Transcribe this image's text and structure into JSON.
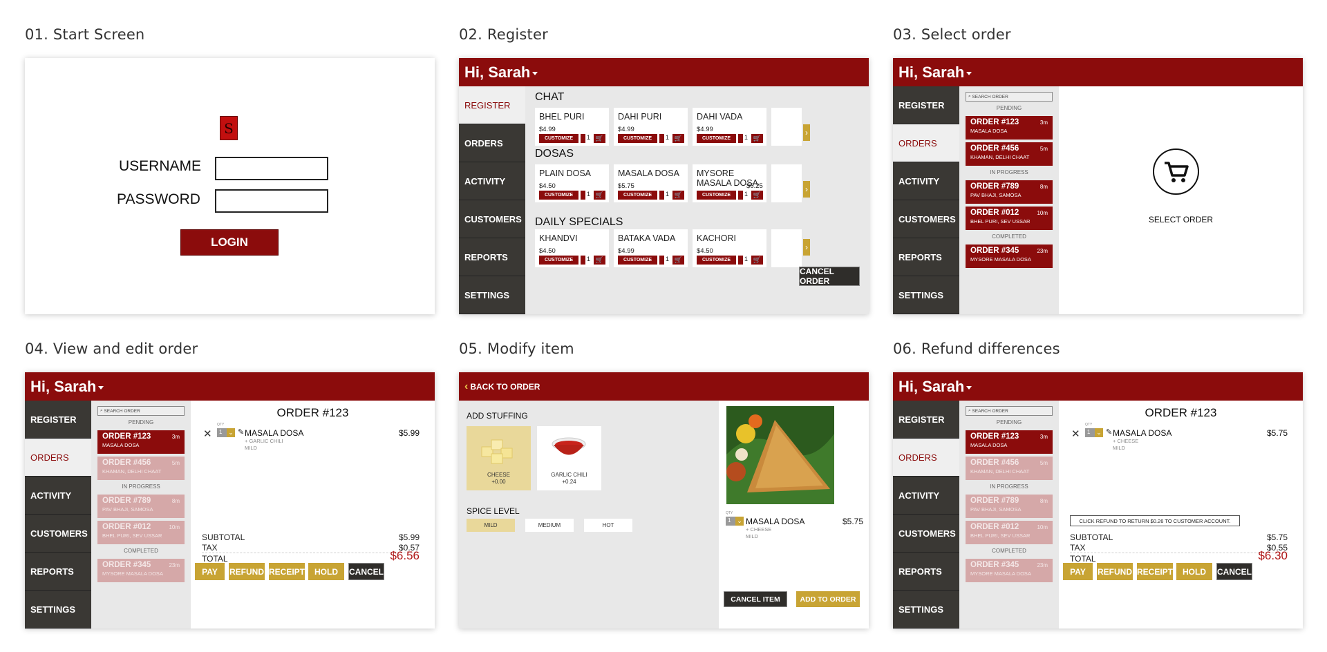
{
  "panels": {
    "p1": {
      "label": "01. Start Screen"
    },
    "p2": {
      "label": "02. Register"
    },
    "p3": {
      "label": "03. Select order"
    },
    "p4": {
      "label": "04. View and edit order"
    },
    "p5": {
      "label": "05. Modify item"
    },
    "p6": {
      "label": "06. Refund differences"
    }
  },
  "login": {
    "logo_letter": "S",
    "username_label": "USERNAME",
    "password_label": "PASSWORD",
    "login_button": "LOGIN"
  },
  "header": {
    "greeting": "Hi, Sarah"
  },
  "nav": [
    "REGISTER",
    "ORDERS",
    "ACTIVITY",
    "CUSTOMERS",
    "REPORTS",
    "SETTINGS"
  ],
  "register": {
    "categories": [
      {
        "name": "CHAT",
        "items": [
          {
            "name": "BHEL PURI",
            "price": "$4.99"
          },
          {
            "name": "DAHI PURI",
            "price": "$4.99"
          },
          {
            "name": "DAHI VADA",
            "price": "$4.99"
          }
        ]
      },
      {
        "name": "DOSAS",
        "items": [
          {
            "name": "PLAIN DOSA",
            "price": "$4.50"
          },
          {
            "name": "MASALA DOSA",
            "price": "$5.75"
          },
          {
            "name": "MYSORE MASALA DOSA",
            "price": "$6.25"
          }
        ]
      },
      {
        "name": "DAILY SPECIALS",
        "items": [
          {
            "name": "KHANDVI",
            "price": "$4.50"
          },
          {
            "name": "BATAKA VADA",
            "price": "$4.99"
          },
          {
            "name": "KACHORI",
            "price": "$4.50"
          }
        ]
      }
    ],
    "customize_label": "CUSTOMIZE",
    "qty": "1",
    "cancel_order": "CANCEL ORDER"
  },
  "orders": {
    "search_placeholder": "SEARCH ORDER",
    "pending_label": "PENDING",
    "in_progress_label": "IN PROGRESS",
    "completed_label": "COMPLETED",
    "list": [
      {
        "number": "ORDER #123",
        "time": "3m",
        "desc": "MASALA DOSA"
      },
      {
        "number": "ORDER #456",
        "time": "5m",
        "desc": "KHAMAN, DELHI CHAAT"
      },
      {
        "number": "ORDER #789",
        "time": "8m",
        "desc": "PAV BHAJI, SAMOSA"
      },
      {
        "number": "ORDER #012",
        "time": "10m",
        "desc": "BHEL PURI, SEV USSAR"
      },
      {
        "number": "ORDER #345",
        "time": "23m",
        "desc": "MYSORE MASALA DOSA"
      }
    ],
    "select_order": "SELECT ORDER"
  },
  "order_view": {
    "title": "ORDER #123",
    "qty_label": "QTY",
    "qty": "1",
    "item_name": "MASALA DOSA",
    "item_price": "$5.99",
    "mod1": "+ GARLIC CHILI",
    "mod2": "MILD",
    "subtotal_label": "SUBTOTAL",
    "subtotal": "$5.99",
    "tax_label": "TAX",
    "tax": "$0.57",
    "total_label": "TOTAL",
    "total": "$6.56",
    "buttons": [
      "PAY",
      "REFUND",
      "RECEIPT",
      "HOLD",
      "CANCEL"
    ]
  },
  "modify": {
    "back": "BACK TO ORDER",
    "add_stuffing": "ADD STUFFING",
    "stuffing": [
      {
        "name": "CHEESE",
        "price": "+0.00"
      },
      {
        "name": "GARLIC CHILI",
        "price": "+0.24"
      }
    ],
    "spice_level": "SPICE LEVEL",
    "spice": [
      "MILD",
      "MEDIUM",
      "HOT"
    ],
    "qty_label": "QTY",
    "qty": "1",
    "item_name": "MASALA DOSA",
    "item_price": "$5.75",
    "mod1": "+ CHEESE",
    "mod2": "MILD",
    "cancel_item": "CANCEL ITEM",
    "add_to_order": "ADD TO ORDER"
  },
  "refund": {
    "title": "ORDER #123",
    "qty_label": "QTY",
    "qty": "1",
    "item_name": "MASALA DOSA",
    "item_price": "$5.75",
    "mod1": "+ CHEESE",
    "mod2": "MILD",
    "notice": "CLICK REFUND TO RETURN $0.26 TO CUSTOMER ACCOUNT.",
    "subtotal_label": "SUBTOTAL",
    "subtotal": "$5.75",
    "tax_label": "TAX",
    "tax": "$0.55",
    "total_label": "TOTAL",
    "total": "$6.30",
    "buttons": [
      "PAY",
      "REFUND",
      "RECEIPT",
      "HOLD",
      "CANCEL"
    ]
  },
  "colors": {
    "brand": "#8b0c0c",
    "accent": "#c8a434",
    "sidebar": "#3a3834"
  }
}
